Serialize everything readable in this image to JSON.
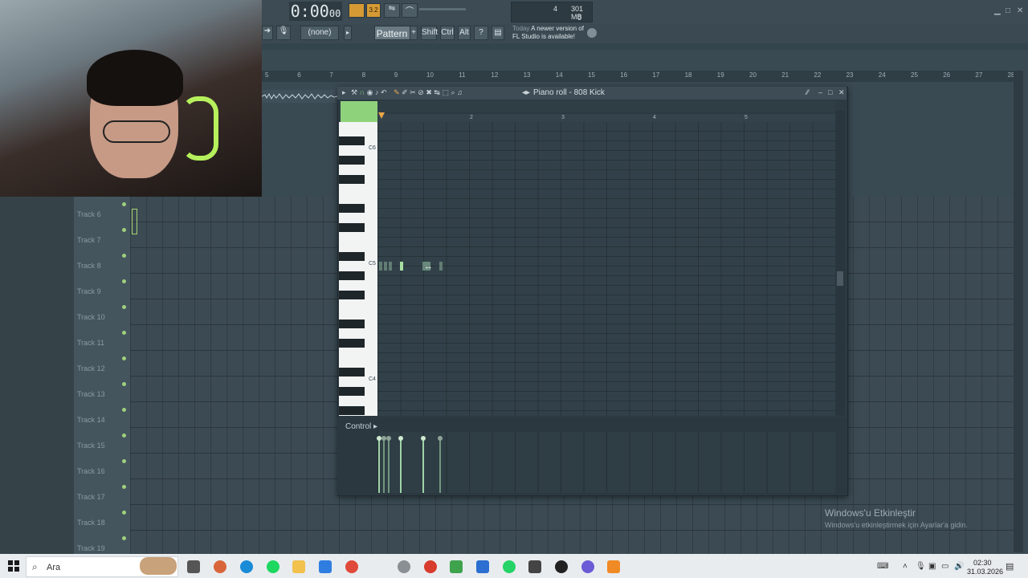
{
  "transport": {
    "time_main": "0:00",
    "time_sub": "00",
    "time_mode_label": "M:S:CS"
  },
  "toolbar": {
    "pattern": "Pattern 1",
    "none_select": "(none)",
    "shift": "Shift",
    "ctrl": "Ctrl",
    "alt": "Alt",
    "cpu_value": "4",
    "memory": "301 MB",
    "poly": "0"
  },
  "hint": {
    "today": "Today",
    "line1": "A newer version of",
    "line2": "FL Studio is available!"
  },
  "playlist": {
    "ruler": [
      "5",
      "6",
      "7",
      "8",
      "9",
      "10",
      "11",
      "12",
      "13",
      "14",
      "15",
      "16",
      "17",
      "18",
      "19",
      "20",
      "21",
      "22",
      "23",
      "24",
      "25",
      "26",
      "27",
      "28"
    ],
    "tracks": [
      "Track 6",
      "Track 7",
      "Track 8",
      "Track 9",
      "Track 10",
      "Track 11",
      "Track 12",
      "Track 13",
      "Track 14",
      "Track 15",
      "Track 16",
      "Track 17",
      "Track 18",
      "Track 19"
    ]
  },
  "piano_roll": {
    "title": "Piano roll - 808 Kick",
    "ruler": [
      "2",
      "3",
      "4",
      "5"
    ],
    "key_labels": {
      "c6": "C6",
      "c5": "C5",
      "c4": "C4"
    },
    "control_label": "Control"
  },
  "watermark": {
    "title": "Windows'u Etkinleştir",
    "subtitle": "Windows'u etkinleştirmek için Ayarlar'a gidin."
  },
  "taskbar": {
    "search_placeholder": "Ara",
    "time": "02:30",
    "date": "31.03.2026"
  }
}
